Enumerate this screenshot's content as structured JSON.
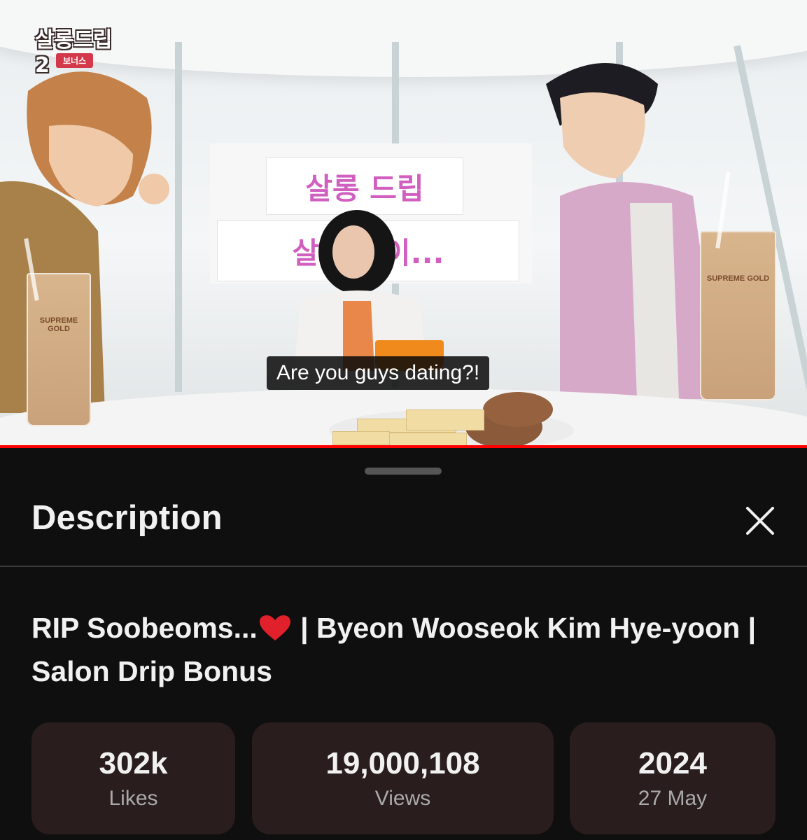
{
  "video": {
    "subtitle": "Are you guys dating?!",
    "sign_line1": "살롱 드립",
    "sign_line2": "살롱 같이...",
    "cup_label": "SUPREME GOLD",
    "logo_text": "살롱드립2",
    "logo_sub": "보너스",
    "progress_fraction": 1.0
  },
  "sheet": {
    "title": "Description",
    "close_icon": "close-icon",
    "video_title_part1": "RIP Soobeoms...",
    "video_title_part2": " | Byeon Wooseok Kim Hye-yoon | Salon Drip Bonus",
    "heart_icon": "red-heart-icon",
    "stats": [
      {
        "value": "302k",
        "label": "Likes"
      },
      {
        "value": "19,000,108",
        "label": "Views"
      },
      {
        "value": "2024",
        "label": "27 May"
      }
    ]
  },
  "colors": {
    "background": "#0f0f0f",
    "stat_card": "#2a1d1d",
    "heart": "#e0202a",
    "progress": "#ff0000"
  }
}
